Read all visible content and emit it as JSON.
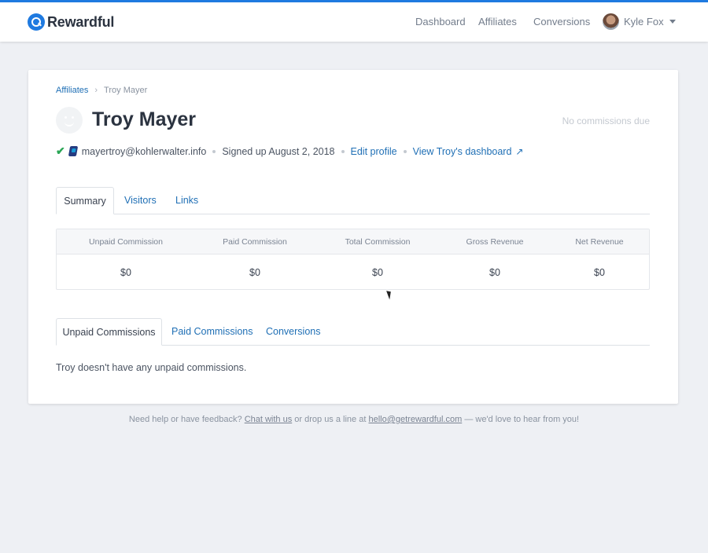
{
  "app": {
    "brand": "Rewardful",
    "nav": {
      "dashboard": "Dashboard",
      "affiliates": "Affiliates",
      "conversions": "Conversions"
    },
    "user": {
      "name": "Kyle Fox"
    }
  },
  "breadcrumb": {
    "parent": "Affiliates",
    "separator": "›",
    "current": "Troy Mayer"
  },
  "profile": {
    "name": "Troy Mayer",
    "commission_status": "No commissions due",
    "verified_glyph": "✔",
    "email": "mayertroy@kohlerwalter.info",
    "signed_up": "Signed up August 2, 2018",
    "edit_link": "Edit profile",
    "dashboard_link": "View Troy's dashboard",
    "external_glyph": "↗"
  },
  "tabs_primary": [
    {
      "label": "Summary",
      "active": true
    },
    {
      "label": "Visitors",
      "active": false
    },
    {
      "label": "Links",
      "active": false
    }
  ],
  "stats": {
    "headers": [
      "Unpaid Commission",
      "Paid Commission",
      "Total Commission",
      "Gross Revenue",
      "Net Revenue"
    ],
    "values": [
      "$0",
      "$0",
      "$0",
      "$0",
      "$0"
    ]
  },
  "tabs_secondary": [
    {
      "label": "Unpaid Commissions",
      "active": true
    },
    {
      "label": "Paid Commissions",
      "active": false
    },
    {
      "label": "Conversions",
      "active": false
    }
  ],
  "empty_message": "Troy doesn't have any unpaid commissions.",
  "footer": {
    "prefix": "Need help or have feedback?",
    "chat_link": "Chat with us",
    "middle": "or drop us a line at",
    "email_link": "hello@getrewardful.com",
    "suffix": "— we'd love to hear from you!"
  },
  "colors": {
    "accent": "#1f7ae0",
    "link": "#1f6fb5",
    "success": "#2aa655",
    "background": "#eef0f4"
  },
  "icons": [
    "logo-icon",
    "chevron-down-icon",
    "checkmark-icon",
    "paypal-icon",
    "external-link-icon",
    "default-avatar-icon"
  ]
}
